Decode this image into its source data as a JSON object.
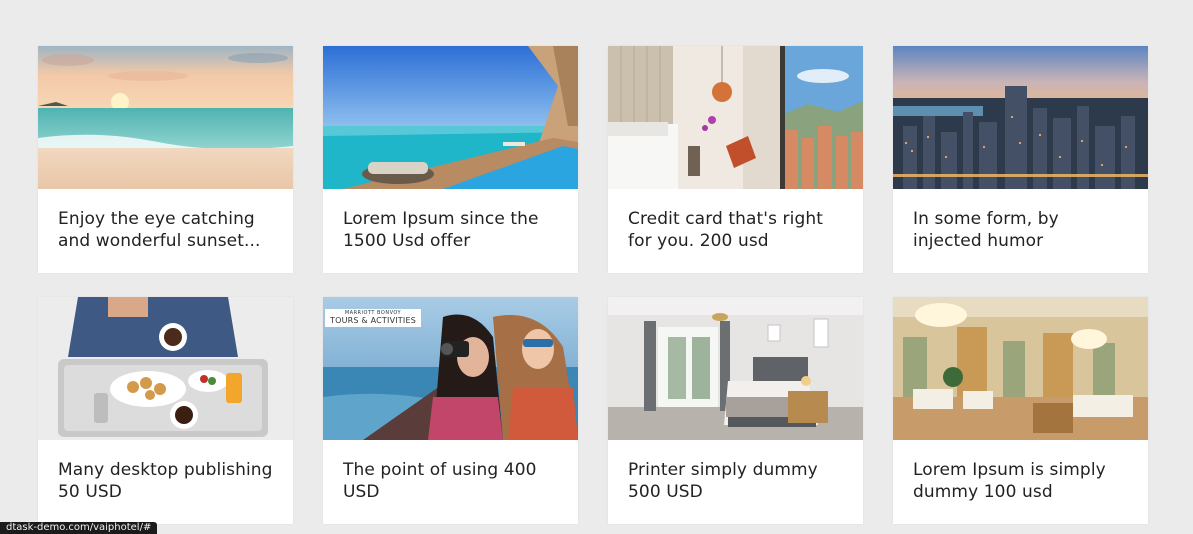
{
  "cards": [
    {
      "caption": "Enjoy the eye catching and wonderful sunset...",
      "image": "beach-sunset-photo"
    },
    {
      "caption": "Lorem Ipsum since the 1500 Usd offer",
      "image": "infinity-pool-deck-photo"
    },
    {
      "caption": "Credit card that's right for you. 200 usd",
      "image": "hotel-room-city-view-photo"
    },
    {
      "caption": "In some form, by injected humor",
      "image": "city-skyline-dusk-photo"
    },
    {
      "caption": "Many desktop publishing 50 USD",
      "image": "breakfast-tray-photo"
    },
    {
      "caption": "The point of using 400 USD",
      "image": "tourists-camera-boat-photo",
      "brand_line1": "MARRIOTT BONVOY",
      "brand_line2": "TOURS & ACTIVITIES"
    },
    {
      "caption": "Printer simply dummy 500 USD",
      "image": "hotel-bedroom-photo"
    },
    {
      "caption": "Lorem Ipsum is simply dummy 100 usd",
      "image": "ballroom-dining-photo"
    }
  ],
  "status_bar": {
    "url": "dtask-demo.com/vaiphotel/#"
  }
}
